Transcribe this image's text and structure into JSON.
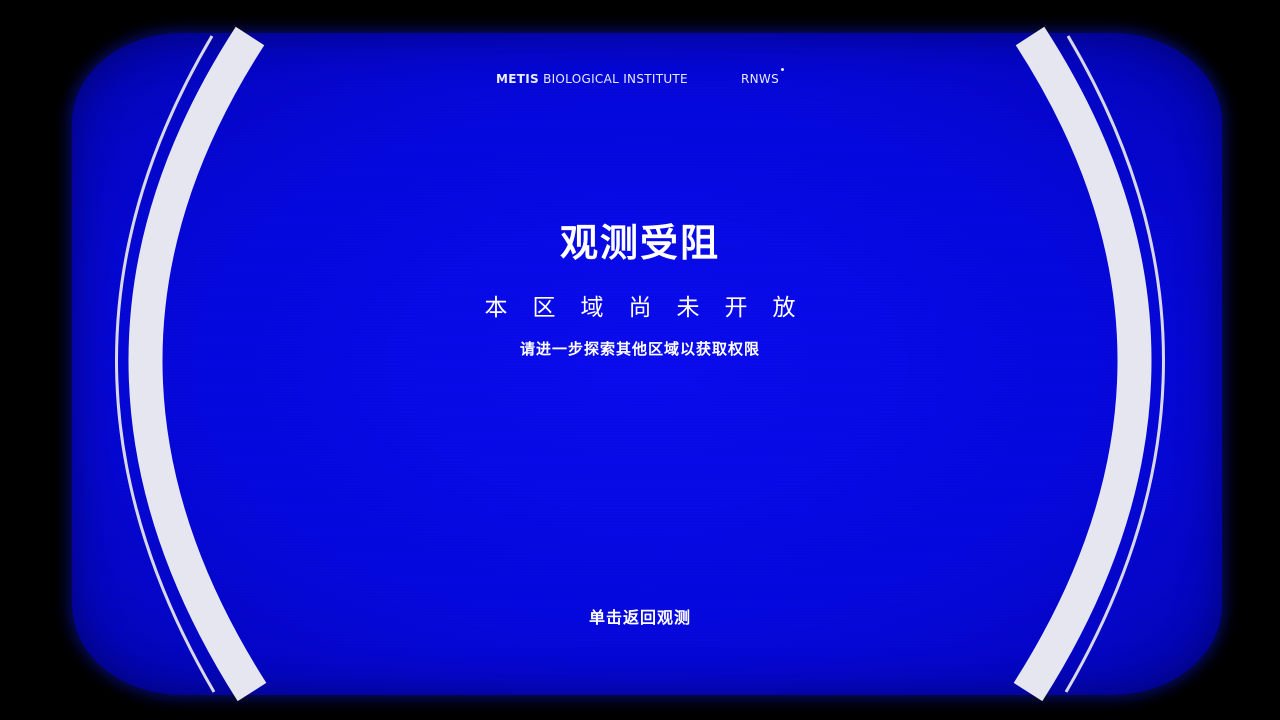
{
  "header": {
    "brand_strong": "METIS",
    "brand_rest": "BIOLOGICAL INSTITUTE",
    "code": "RNWS"
  },
  "main": {
    "title": "观测受阻",
    "subtitle": "本区域尚未开放",
    "hint": "请进一步探索其他区域以获取权限",
    "back_label": "单击返回观测"
  },
  "colors": {
    "screen_blue": "#0608e0",
    "bezel_black": "#000000",
    "ring_white": "#e6e6f0",
    "text_white": "#ffffff"
  }
}
